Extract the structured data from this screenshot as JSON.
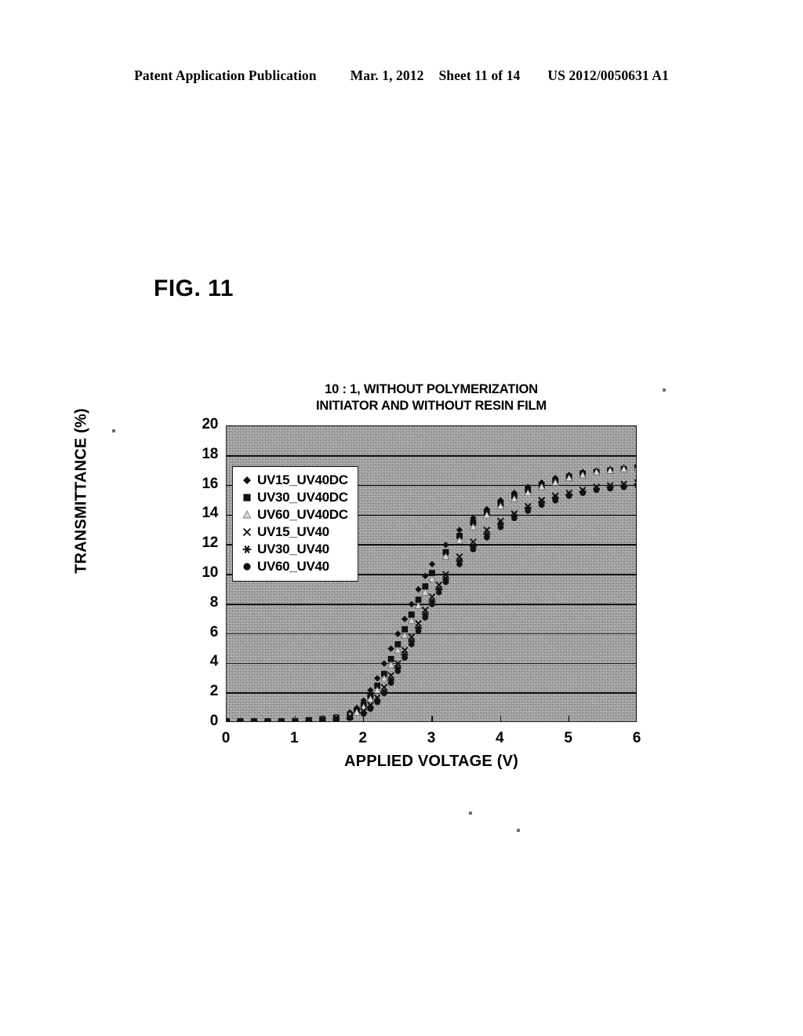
{
  "header": {
    "publication": "Patent Application Publication",
    "date": "Mar. 1, 2012",
    "sheet": "Sheet 11 of 14",
    "docnum": "US 2012/0050631 A1"
  },
  "figure": {
    "label": "FIG. 11"
  },
  "chart_data": {
    "type": "scatter",
    "title": "10 : 1, WITHOUT POLYMERIZATION INITIATOR AND WITHOUT RESIN FILM",
    "title_line1": "10 : 1, WITHOUT POLYMERIZATION",
    "title_line2": "INITIATOR AND WITHOUT RESIN FILM",
    "xlabel": "APPLIED VOLTAGE (V)",
    "ylabel": "TRANSMITTANCE (%)",
    "xlim": [
      0,
      6
    ],
    "ylim": [
      0,
      20
    ],
    "xticks": [
      "0",
      "1",
      "2",
      "3",
      "4",
      "5",
      "6"
    ],
    "yticks": [
      "0",
      "2",
      "4",
      "6",
      "8",
      "10",
      "12",
      "14",
      "16",
      "18",
      "20"
    ],
    "grid": "horizontal",
    "legend_position": "inside-top-left",
    "plot_background": "#9a9a9a",
    "marker_color": "#111111",
    "series": [
      {
        "name": "UV15_UV40DC",
        "marker": "diamond",
        "x": [
          0.0,
          0.2,
          0.4,
          0.6,
          0.8,
          1.0,
          1.2,
          1.4,
          1.6,
          1.8,
          1.9,
          2.0,
          2.1,
          2.2,
          2.3,
          2.4,
          2.5,
          2.6,
          2.7,
          2.8,
          2.9,
          3.0,
          3.2,
          3.4,
          3.6,
          3.8,
          4.0,
          4.2,
          4.4,
          4.6,
          4.8,
          5.0,
          5.2,
          5.4,
          5.6,
          5.8,
          6.0
        ],
        "y": [
          0.1,
          0.1,
          0.1,
          0.1,
          0.1,
          0.15,
          0.2,
          0.3,
          0.4,
          0.7,
          1.0,
          1.5,
          2.2,
          3.0,
          4.0,
          5.0,
          6.0,
          7.0,
          8.0,
          9.0,
          9.9,
          10.7,
          12.0,
          13.0,
          13.8,
          14.4,
          15.0,
          15.5,
          15.9,
          16.2,
          16.5,
          16.7,
          16.9,
          17.0,
          17.1,
          17.2,
          17.3
        ]
      },
      {
        "name": "UV30_UV40DC",
        "marker": "square",
        "x": [
          0.0,
          0.2,
          0.4,
          0.6,
          0.8,
          1.0,
          1.2,
          1.4,
          1.6,
          1.8,
          1.9,
          2.0,
          2.1,
          2.2,
          2.3,
          2.4,
          2.5,
          2.6,
          2.7,
          2.8,
          2.9,
          3.0,
          3.2,
          3.4,
          3.6,
          3.8,
          4.0,
          4.2,
          4.4,
          4.6,
          4.8,
          5.0,
          5.2,
          5.4,
          5.6,
          5.8,
          6.0
        ],
        "y": [
          0.1,
          0.1,
          0.1,
          0.1,
          0.1,
          0.12,
          0.18,
          0.25,
          0.35,
          0.55,
          0.8,
          1.2,
          1.8,
          2.5,
          3.3,
          4.3,
          5.3,
          6.3,
          7.3,
          8.3,
          9.2,
          10.1,
          11.5,
          12.6,
          13.5,
          14.2,
          14.8,
          15.3,
          15.7,
          16.0,
          16.3,
          16.6,
          16.8,
          16.9,
          17.0,
          17.1,
          17.2
        ]
      },
      {
        "name": "UV60_UV40DC",
        "marker": "triangle",
        "x": [
          0.0,
          0.2,
          0.4,
          0.6,
          0.8,
          1.0,
          1.2,
          1.4,
          1.6,
          1.8,
          1.9,
          2.0,
          2.1,
          2.2,
          2.3,
          2.4,
          2.5,
          2.6,
          2.7,
          2.8,
          2.9,
          3.0,
          3.2,
          3.4,
          3.6,
          3.8,
          4.0,
          4.2,
          4.4,
          4.6,
          4.8,
          5.0,
          5.2,
          5.4,
          5.6,
          5.8,
          6.0
        ],
        "y": [
          0.1,
          0.1,
          0.1,
          0.1,
          0.1,
          0.12,
          0.16,
          0.22,
          0.32,
          0.5,
          0.7,
          1.05,
          1.6,
          2.2,
          3.0,
          3.9,
          4.9,
          5.9,
          6.9,
          7.9,
          8.8,
          9.7,
          11.2,
          12.3,
          13.2,
          14.0,
          14.6,
          15.1,
          15.5,
          15.9,
          16.2,
          16.5,
          16.7,
          16.9,
          17.0,
          17.1,
          17.2
        ]
      },
      {
        "name": "UV15_UV40",
        "marker": "cross",
        "x": [
          0.0,
          0.2,
          0.4,
          0.6,
          0.8,
          1.0,
          1.2,
          1.4,
          1.6,
          1.8,
          2.0,
          2.1,
          2.2,
          2.3,
          2.4,
          2.5,
          2.6,
          2.7,
          2.8,
          2.9,
          3.0,
          3.1,
          3.2,
          3.4,
          3.6,
          3.8,
          4.0,
          4.2,
          4.4,
          4.6,
          4.8,
          5.0,
          5.2,
          5.4,
          5.6,
          5.8,
          6.0
        ],
        "y": [
          0.1,
          0.1,
          0.1,
          0.1,
          0.1,
          0.1,
          0.15,
          0.2,
          0.3,
          0.4,
          0.8,
          1.2,
          1.7,
          2.4,
          3.2,
          4.0,
          4.9,
          5.8,
          6.7,
          7.6,
          8.5,
          9.3,
          10.0,
          11.2,
          12.2,
          13.0,
          13.6,
          14.1,
          14.6,
          15.0,
          15.3,
          15.5,
          15.7,
          15.9,
          16.0,
          16.1,
          16.2
        ]
      },
      {
        "name": "UV30_UV40",
        "marker": "star",
        "x": [
          0.0,
          0.2,
          0.4,
          0.6,
          0.8,
          1.0,
          1.2,
          1.4,
          1.6,
          1.8,
          2.0,
          2.1,
          2.2,
          2.3,
          2.4,
          2.5,
          2.6,
          2.7,
          2.8,
          2.9,
          3.0,
          3.1,
          3.2,
          3.4,
          3.6,
          3.8,
          4.0,
          4.2,
          4.4,
          4.6,
          4.8,
          5.0,
          5.2,
          5.4,
          5.6,
          5.8,
          6.0
        ],
        "y": [
          0.1,
          0.1,
          0.1,
          0.1,
          0.1,
          0.1,
          0.14,
          0.18,
          0.26,
          0.36,
          0.7,
          1.05,
          1.5,
          2.1,
          2.9,
          3.7,
          4.6,
          5.5,
          6.4,
          7.3,
          8.2,
          9.0,
          9.7,
          10.9,
          11.9,
          12.7,
          13.4,
          14.0,
          14.5,
          14.9,
          15.2,
          15.4,
          15.6,
          15.8,
          15.9,
          16.0,
          16.1
        ]
      },
      {
        "name": "UV60_UV40",
        "marker": "circle",
        "x": [
          0.0,
          0.2,
          0.4,
          0.6,
          0.8,
          1.0,
          1.2,
          1.4,
          1.6,
          1.8,
          2.0,
          2.1,
          2.2,
          2.3,
          2.4,
          2.5,
          2.6,
          2.7,
          2.8,
          2.9,
          3.0,
          3.1,
          3.2,
          3.4,
          3.6,
          3.8,
          4.0,
          4.2,
          4.4,
          4.6,
          4.8,
          5.0,
          5.2,
          5.4,
          5.6,
          5.8,
          6.0
        ],
        "y": [
          0.1,
          0.1,
          0.1,
          0.1,
          0.1,
          0.1,
          0.13,
          0.17,
          0.24,
          0.33,
          0.62,
          0.95,
          1.4,
          2.0,
          2.7,
          3.5,
          4.4,
          5.3,
          6.2,
          7.1,
          8.0,
          8.8,
          9.5,
          10.7,
          11.7,
          12.5,
          13.2,
          13.8,
          14.3,
          14.7,
          15.0,
          15.3,
          15.5,
          15.7,
          15.8,
          15.9,
          16.0
        ]
      }
    ],
    "legend": [
      {
        "label": "UV15_UV40DC",
        "marker": "diamond"
      },
      {
        "label": "UV30_UV40DC",
        "marker": "square"
      },
      {
        "label": "UV60_UV40DC",
        "marker": "triangle"
      },
      {
        "label": "UV15_UV40",
        "marker": "cross"
      },
      {
        "label": "UV30_UV40",
        "marker": "star"
      },
      {
        "label": "UV60_UV40",
        "marker": "circle"
      }
    ]
  }
}
